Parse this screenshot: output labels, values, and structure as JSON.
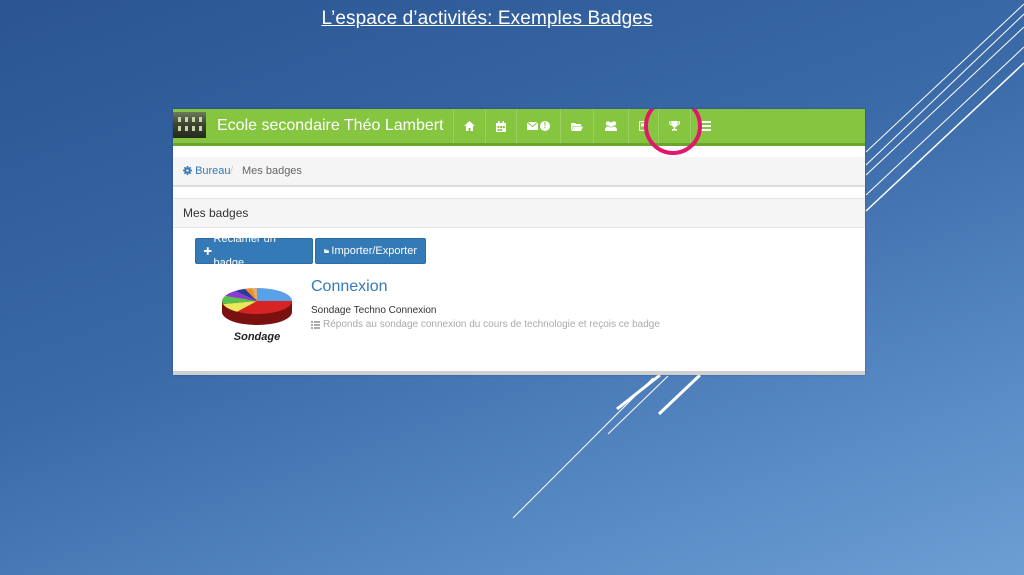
{
  "slide": {
    "title": "L’espace d’activités: Exemples Badges"
  },
  "app": {
    "school_name": "Ecole secondaire Théo Lambert",
    "nav_icons": [
      "home-icon",
      "calendar-icon",
      "envelope-alert-icon",
      "folder-open-icon",
      "users-icon",
      "mobile-icon",
      "trophy-icon",
      "list-icon"
    ],
    "highlight_color": "#e0186b",
    "navbar_color": "#86c53f"
  },
  "breadcrumb": {
    "home": "Bureau",
    "separator": "/",
    "current": "Mes badges"
  },
  "panel": {
    "title": "Mes badges"
  },
  "buttons": {
    "claim": "Réclamer un badge",
    "import_export": "Importer/Exporter"
  },
  "badge": {
    "title": "Connexion",
    "name": "Sondage Techno Connexion",
    "description": "Réponds au sondage connexion du cours de technologie et reçois ce badge",
    "image_label": "Sondage"
  }
}
